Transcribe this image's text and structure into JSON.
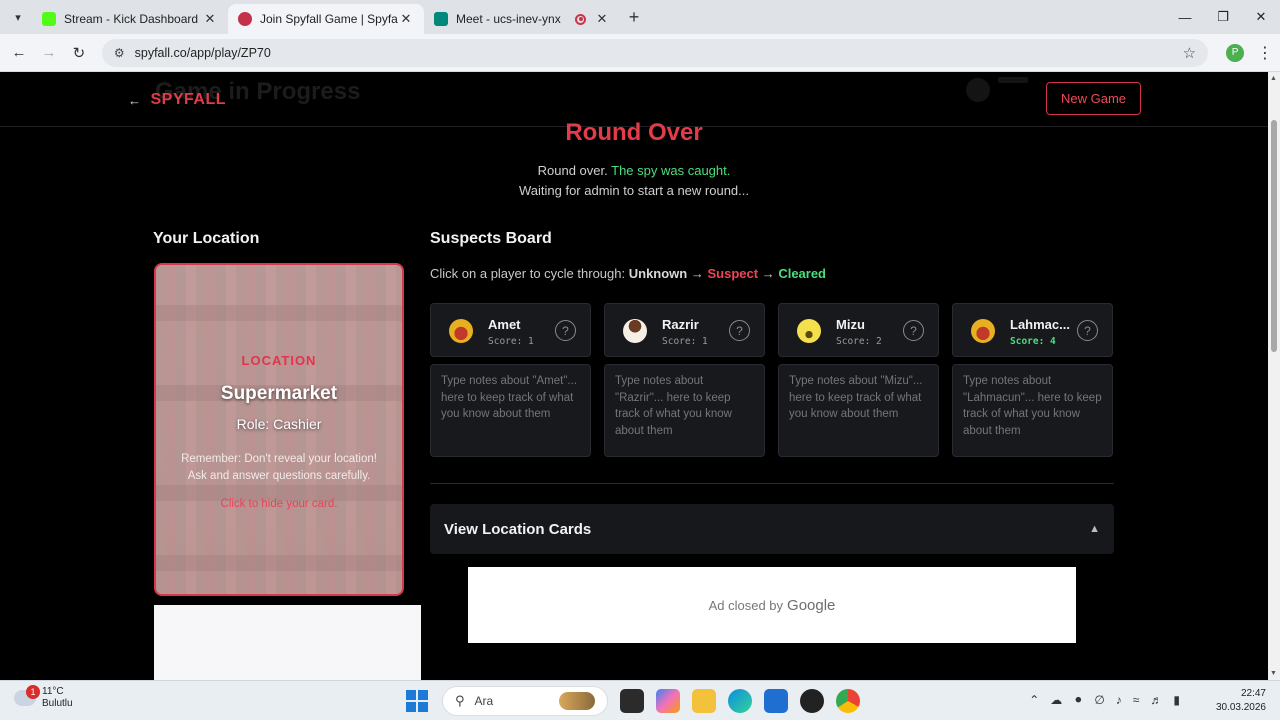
{
  "browser": {
    "tabs": [
      {
        "title": "Stream - Kick Dashboard",
        "favicon_color": "#53fc18",
        "active": false
      },
      {
        "title": "Join Spyfall Game | Spyfall Online",
        "favicon_color": "#c4314b",
        "active": true
      },
      {
        "title": "Meet - ucs-inev-ynx",
        "favicon_color": "#00897b",
        "active": false
      }
    ],
    "url": "spyfall.co/app/play/ZP70",
    "profile_initial": "P"
  },
  "header": {
    "logo": "SPYFALL",
    "ghost_title": "Game in Progress",
    "new_game": "New Game"
  },
  "round": {
    "title": "Round Over",
    "msg_prefix": "Round over.",
    "msg_highlight": "The spy was caught.",
    "waiting": "Waiting for admin to start a new round..."
  },
  "location": {
    "heading": "Your Location",
    "label": "LOCATION",
    "name": "Supermarket",
    "role": "Role: Cashier",
    "reminder": "Remember: Don't reveal your location! Ask and answer questions carefully.",
    "hide": "Click to hide your card."
  },
  "suspects": {
    "heading": "Suspects Board",
    "hint_prefix": "Click on a player to cycle through:",
    "states": [
      "Unknown",
      "Suspect",
      "Cleared"
    ],
    "arrow": "→",
    "players": [
      {
        "name": "Amet",
        "score": "Score: 1",
        "avatar_color": "#e8b020",
        "note": "Type notes about \"Amet\"... here to keep track of what you know about them",
        "highlight": false
      },
      {
        "name": "Razrir",
        "score": "Score: 1",
        "avatar_color": "#f5efe6",
        "note": "Type notes about \"Razrir\"... here to keep track of what you know about them",
        "highlight": false
      },
      {
        "name": "Mizu",
        "score": "Score: 2",
        "avatar_color": "#f4e04d",
        "note": "Type notes about \"Mizu\"... here to keep track of what you know about them",
        "highlight": false
      },
      {
        "name": "Lahmac...",
        "score": "Score: 4",
        "avatar_color": "#e8b020",
        "note": "Type notes about \"Lahmacun\"... here to keep track of what you know about them",
        "highlight": true
      }
    ]
  },
  "cards": {
    "toggle": "View Location Cards"
  },
  "ad": {
    "text": "Ad closed by",
    "brand": "Google"
  },
  "taskbar": {
    "weather_temp": "11°C",
    "weather_desc": "Bulutlu",
    "weather_badge": "1",
    "search": "Ara",
    "time": "22:47",
    "date": "30.03.2026"
  }
}
